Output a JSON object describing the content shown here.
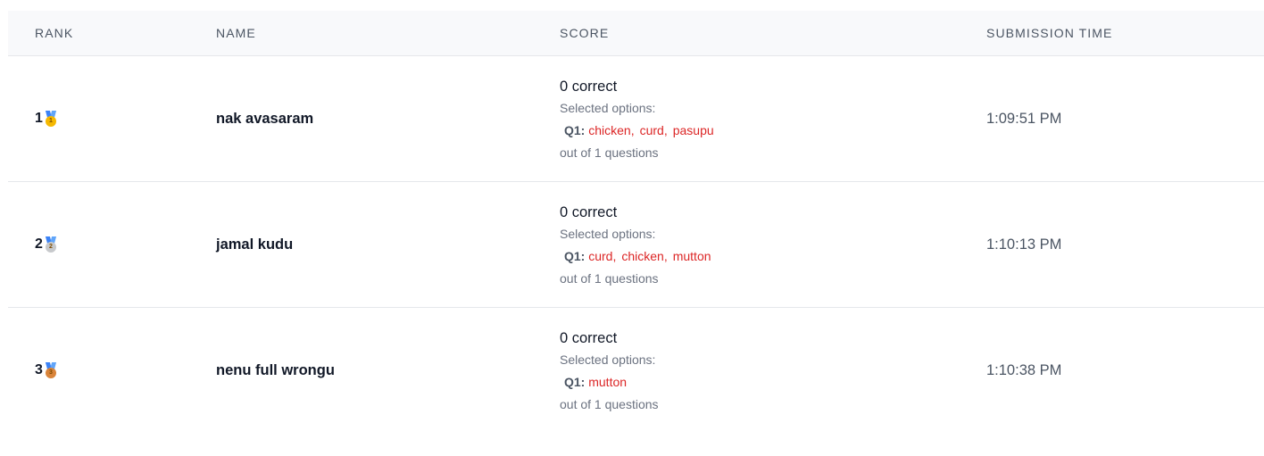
{
  "columns": {
    "rank": "Rank",
    "name": "Name",
    "score": "Score",
    "submission_time": "Submission Time"
  },
  "colors": {
    "gold": "#f5b800",
    "silver": "#c7c9cc",
    "bronze": "#d9843a",
    "option_text": "#dc2626"
  },
  "rows": [
    {
      "rank": "1",
      "medal": "gold-medal-icon",
      "medal_number": "1",
      "name": "nak avasaram",
      "correct": "0 correct",
      "selected_label": "Selected options:",
      "question": "Q1:",
      "options": [
        "chicken",
        "curd",
        "pasupu"
      ],
      "out_of": "out of 1 questions",
      "time": "1:09:51 PM"
    },
    {
      "rank": "2",
      "medal": "silver-medal-icon",
      "medal_number": "2",
      "name": "jamal kudu",
      "correct": "0 correct",
      "selected_label": "Selected options:",
      "question": "Q1:",
      "options": [
        "curd",
        "chicken",
        "mutton"
      ],
      "out_of": "out of 1 questions",
      "time": "1:10:13 PM"
    },
    {
      "rank": "3",
      "medal": "bronze-medal-icon",
      "medal_number": "3",
      "name": "nenu full wrongu",
      "correct": "0 correct",
      "selected_label": "Selected options:",
      "question": "Q1:",
      "options": [
        "mutton"
      ],
      "out_of": "out of 1 questions",
      "time": "1:10:38 PM"
    }
  ]
}
